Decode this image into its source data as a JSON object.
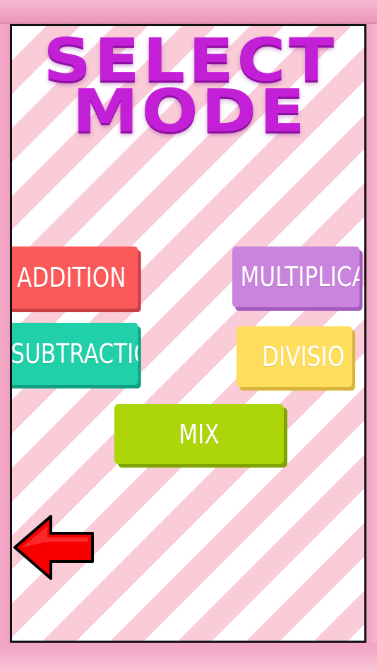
{
  "title": {
    "line1": "SELECT",
    "line2": "MODE"
  },
  "modes": {
    "addition": "ADDITION",
    "multiplication": "MULTIPLICATI",
    "subtraction": "SUBTRACTION",
    "division": "DIVISIO",
    "mix": "MIX"
  },
  "icons": {
    "back": "left-arrow-icon"
  },
  "colors": {
    "title": "#c21fd6",
    "addition": "#fc5a5a",
    "multiplication": "#c985dd",
    "subtraction": "#20d0a8",
    "division": "#ffde5e",
    "mix": "#acd609",
    "back_arrow": "#f80000",
    "stripe_pink": "#f9ccd8",
    "frame_pink": "#f3a9c6"
  }
}
